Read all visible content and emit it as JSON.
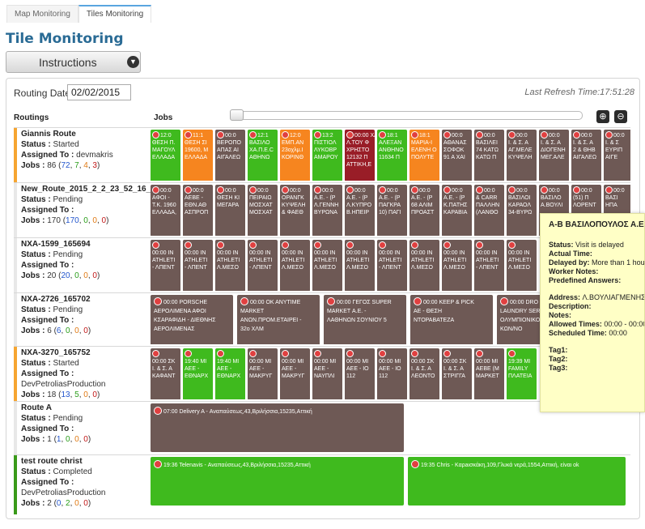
{
  "tabs": [
    "Map Monitoring",
    "Tiles Monitoring"
  ],
  "page_title": "Tile Monitoring",
  "instructions_label": "Instructions",
  "routing_date": {
    "label": "Routing Date",
    "value": "02/02/2015"
  },
  "last_refresh": "Last Refresh Time:17:51:28",
  "columns": {
    "routings": "Routings",
    "jobs": "Jobs"
  },
  "colors": {
    "green": "#3fba1e",
    "orange": "#f6851f",
    "dark": "#6e5955",
    "red": "#991d27",
    "started": "#f6a531",
    "completed": "#3a9a1a",
    "pending": "#e8e8e8"
  },
  "routes": [
    {
      "name": "Giannis Route",
      "status": "Started",
      "assigned": "devmakris",
      "jobs_total": "86",
      "jobs_a": "72",
      "jobs_b": "7",
      "jobs_c": "4",
      "jobs_d": "3",
      "tiles": [
        {
          "c": "g",
          "l": [
            "12:0",
            "ΘΕΣΗ Π.",
            "ΜΑΓΟΥΛ",
            "ΕΛΛΑΔΑ"
          ]
        },
        {
          "c": "o",
          "l": [
            "11:1",
            "ΘΕΣΗ ΣΙ",
            "19600, Μ",
            "ΕΛΛΑΔΑ"
          ]
        },
        {
          "c": "d",
          "l": [
            "00:0",
            "ΒΕΡΟΠΟ",
            "ΑΠΑΣ ΑΙ",
            "ΑΙΓΑΛΕΩ"
          ]
        },
        {
          "c": "g",
          "l": [
            "12:1",
            "ΒΑΣΙΛΟ",
            "ΧΑ.Π.Ε.C",
            "ΑΘΗΝΩ"
          ]
        },
        {
          "c": "o",
          "l": [
            "12:0",
            "ΕΜΠ.ΑΝ",
            "23οχλμ.Ι",
            "ΚΟΡΙΝΘ"
          ]
        },
        {
          "c": "g",
          "l": [
            "13:2",
            "ΠΙΣΤΙΟΛ",
            "ΛΥΚΟΒΡ",
            "ΑΜΑΡΟΥ"
          ]
        },
        {
          "c": "r",
          "l": [
            "00:00 ΧΑ",
            "Λ.ΤΟΥ Φ",
            "ΧΡΗΣΤΟ",
            "12132 Π",
            "ΑΤΤΙΚΗ,Ε"
          ]
        },
        {
          "c": "g",
          "l": [
            "18:1",
            "ΑΛΕΞΑΝ",
            "ΑΝΘΗΝΟ",
            "11634 Π"
          ]
        },
        {
          "c": "o",
          "l": [
            "18:1",
            "ΜΑΡΙΑ-Ι",
            "ΕΛΕΝΗ Ο",
            "ΠΟΛΥΤΕ"
          ]
        },
        {
          "c": "d",
          "l": [
            "00:0",
            "ΑΘΑΝΑΣ",
            "ΣΟΦΟΚ",
            "91 Α ΧΑΙ"
          ]
        },
        {
          "c": "d",
          "l": [
            "00:0",
            "ΒΑΣΙΛΕΙ",
            "74 ΚΑΤΩ",
            "ΚΑΤΩ Π"
          ]
        },
        {
          "c": "d",
          "l": [
            "00:0",
            "Ι. & Σ. Α",
            "ΑΓ.ΜΕΛΕ",
            "ΚΥΨΕΛΗ"
          ]
        },
        {
          "c": "d",
          "l": [
            "00:0",
            "Ι. & Σ. Α",
            "ΔΙΟΓΕΝΗ",
            "ΜΕΓ.ΑΛΕ"
          ]
        },
        {
          "c": "d",
          "l": [
            "00:0",
            "Ι. & Σ. Α",
            "2 & ΘΗΒ",
            "ΑΙΓΑΛΕΩ"
          ]
        },
        {
          "c": "d",
          "l": [
            "00:0",
            "Ι. & Σ",
            "ΕΥΡΙΠ",
            "ΑΙΓΕ"
          ]
        }
      ]
    },
    {
      "name": "New_Route_2015_2_2_23_52_16_748",
      "status": "Pending",
      "assigned": "",
      "jobs_total": "170",
      "jobs_a": "170",
      "jobs_b": "0",
      "jobs_c": "0",
      "jobs_d": "0",
      "tiles": [
        {
          "c": "d",
          "l": [
            "00:0",
            "ΑΦΟΙ - ",
            "Τ.Κ. 1960",
            "ΕΛΛΑΔΑ,"
          ]
        },
        {
          "c": "d",
          "l": [
            "00:0",
            "ΑΕΒΕ - ",
            "ΕΘΝ.ΑΘ",
            "ΑΣΠΡΟΠ"
          ]
        },
        {
          "c": "d",
          "l": [
            "00:0",
            "ΘΕΣΗ ΚΙ",
            "ΜΕΓΑΡΑ"
          ]
        },
        {
          "c": "d",
          "l": [
            "00:0",
            "ΠΕΙΡΑΙΩ",
            "ΜΟΣΧΑΤ",
            "ΜΟΣΧΑΤ"
          ]
        },
        {
          "c": "d",
          "l": [
            "00:0",
            "ΟΡΑΝΓΚ",
            "ΚΥΨΕΛΗ",
            "& ΦΑΕΘ"
          ]
        },
        {
          "c": "d",
          "l": [
            "00:0",
            "Α.Ε. - (Ρ",
            "Λ.ΓΕΝΝΗ",
            "ΒΥΡΩΝΑ"
          ]
        },
        {
          "c": "d",
          "l": [
            "00:0",
            "Α.Ε. - (Ρ",
            "Λ.ΚΥΠΡΟ",
            "Β.ΗΠΕΙΡ"
          ]
        },
        {
          "c": "d",
          "l": [
            "00:0",
            "Α.Ε. - (Ρ",
            "ΠΑΓΚΡΑ",
            "10) ΠΑΓΙ"
          ]
        },
        {
          "c": "d",
          "l": [
            "00:0",
            "Α.Ε. - (Ρ",
            "68 ΑΛΙΜ",
            "ΠΡΟΑΣΤ"
          ]
        },
        {
          "c": "d",
          "l": [
            "00:0",
            "Α.Ε. - (Ρ",
            "Κ.ΠΑΤΗΣ",
            "ΚΑΡΑΒΙΑ"
          ]
        },
        {
          "c": "d",
          "l": [
            "00:0",
            "& CARR",
            "ΠΑΛΛΗΝ",
            "(ΛΑΝΘΟ"
          ]
        },
        {
          "c": "d",
          "l": [
            "00:0",
            "ΒΑΣΙΛΟΙ",
            "ΚΑΡΑΟΛ",
            "34-ΒΥΡΩ"
          ]
        },
        {
          "c": "d",
          "l": [
            "00:0",
            "ΒΑΣΙΛΟ",
            "Α.ΒΟΥΛΙ"
          ]
        },
        {
          "c": "d",
          "l": [
            "00:0",
            "(51) Π",
            "ΛΟΡΕΝΤ"
          ]
        },
        {
          "c": "d",
          "l": [
            "00:0",
            "ΒΑΣΙ",
            "ΗΠΑ"
          ]
        }
      ]
    },
    {
      "name": "NXA-1599_165694",
      "status": "Pending",
      "assigned": "",
      "jobs_total": "20",
      "jobs_a": "20",
      "jobs_b": "0",
      "jobs_c": "0",
      "jobs_d": "0",
      "tiles": [
        {
          "c": "d",
          "w": 1,
          "l": [
            "",
            "00:00 IN",
            "ATHLETI",
            "- ΛΠΕΝΤ"
          ]
        },
        {
          "c": "d",
          "w": 1,
          "l": [
            "",
            "00:00 IN",
            "ATHLETI",
            "- ΛΠΕΝΤ"
          ]
        },
        {
          "c": "d",
          "w": 1,
          "l": [
            "",
            "00:00 IN",
            "ATHLETI",
            "Λ.ΜΕΣΟ"
          ]
        },
        {
          "c": "d",
          "w": 1,
          "l": [
            "",
            "00:00 IN",
            "ATHLETI",
            "- ΛΠΕΝΤ"
          ]
        },
        {
          "c": "d",
          "w": 1,
          "l": [
            "",
            "00:00 IN",
            "ATHLETI",
            "Λ.ΜΕΣΟ"
          ]
        },
        {
          "c": "d",
          "w": 1,
          "l": [
            "",
            "00:00 IN",
            "ATHLETI",
            "Λ.ΜΕΣΟ"
          ]
        },
        {
          "c": "d",
          "w": 1,
          "l": [
            "",
            "00:00 IN",
            "ATHLETI",
            "Λ.ΜΕΣΟ"
          ]
        },
        {
          "c": "d",
          "w": 1,
          "l": [
            "",
            "00:00 IN",
            "ATHLETI",
            "- ΛΠΕΝΤ"
          ]
        },
        {
          "c": "d",
          "w": 1,
          "l": [
            "",
            "00:00 IN",
            "ATHLETI",
            "Λ.ΜΕΣΟ"
          ]
        },
        {
          "c": "d",
          "w": 1,
          "l": [
            "",
            "00:00 IN",
            "ATHLETI",
            "Λ.ΜΕΣΟ"
          ]
        },
        {
          "c": "d",
          "w": 1,
          "l": [
            "",
            "00:00 IN",
            "ATHLETI",
            "- ΛΠΕΝΤ"
          ]
        },
        {
          "c": "d",
          "w": 1,
          "l": [
            "",
            "00:00 IN",
            "ATHLETI",
            "Λ.ΜΕΣΟ"
          ]
        }
      ]
    },
    {
      "name": "NXA-2726_165702",
      "status": "Pending",
      "assigned": "",
      "jobs_total": "6",
      "jobs_a": "6",
      "jobs_b": "0",
      "jobs_c": "0",
      "jobs_d": "0",
      "wide": [
        {
          "l": [
            "00:00 PORSCHE",
            "ΑΕΡΟΛΙΜΕΝΑ ΑΦΟΙ",
            "ΚΣΑΡΑΦΙΔΗ - ΔΙΕΘΝΗΣ",
            "ΑΕΡΟΛΙΜΕΝΑΣ"
          ]
        },
        {
          "l": [
            "00:00 OK ANYTIME",
            "MARKET",
            "ΑΝΩΝ.ΠΡΟΜ.ΕΤΑΙΡΕΙ -",
            "32ο ΧΛΜ"
          ]
        },
        {
          "l": [
            "00:00 ΓΕΓΟΣ SUPER",
            "MARKET Α.Ε. -",
            "ΛΑΘΗΝΩΝ ΣΟΥΝΙΟΥ 5"
          ]
        },
        {
          "l": [
            "00:00 KEEP & PICK",
            "ΑΕ - ΘΕΣΗ",
            "ΝΤΟΡΑΒΑΤΕΖΑ"
          ]
        },
        {
          "l": [
            "00:00 DRO",
            "LAUNDRY SERV",
            "ΟΛΥΜΠΙΟΝΙΚΟ",
            "ΚΩΝ/ΝΟ"
          ]
        }
      ]
    },
    {
      "name": "NXA-3270_165752",
      "status": "Started",
      "assigned": "DevPetroliasProduction",
      "jobs_total": "18",
      "jobs_a": "13",
      "jobs_b": "5",
      "jobs_c": "0",
      "jobs_d": "0",
      "tiles": [
        {
          "c": "d",
          "w": 1,
          "l": [
            "",
            "00:00 ΣΚ",
            "Ι. & Σ. Α",
            "ΚΑΦΑΝΤ"
          ]
        },
        {
          "c": "g",
          "w": 1,
          "l": [
            "",
            "19:40 ΜΙ",
            "ΑΕΕ - ",
            "ΕΘΝΑΡΧ"
          ]
        },
        {
          "c": "g",
          "w": 1,
          "l": [
            "",
            "19:40 ΜΙ",
            "ΑΕΕ - ",
            "ΕΘΝΑΡΧ"
          ]
        },
        {
          "c": "d",
          "w": 1,
          "l": [
            "",
            "00:00 ΜΙ",
            "ΑΕΕ - ",
            "ΜΑΚΡΥΓ"
          ]
        },
        {
          "c": "d",
          "w": 1,
          "l": [
            "",
            "00:00 ΜΙ",
            "ΑΕΕ - ",
            "ΜΑΚΡΥΓ"
          ]
        },
        {
          "c": "d",
          "w": 1,
          "l": [
            "",
            "00:00 ΜΙ",
            "ΑΕΕ - ",
            "ΝΑΥΠΛΙ"
          ]
        },
        {
          "c": "d",
          "w": 1,
          "l": [
            "",
            "00:00 ΜΙ",
            "ΑΕΕ - ΙΟ",
            "112"
          ]
        },
        {
          "c": "d",
          "w": 1,
          "l": [
            "",
            "00:00 ΜΙ",
            "ΑΕΕ - ΙΟ",
            "112"
          ]
        },
        {
          "c": "d",
          "w": 1,
          "l": [
            "",
            "00:00 ΣΚ",
            "Ι. & Σ. Α",
            "ΛΕΟΝΤΟ"
          ]
        },
        {
          "c": "d",
          "w": 1,
          "l": [
            "",
            "00:00 ΣΚ",
            "Ι. & Σ. Α",
            "ΣΤΡΙΓΓΑ"
          ]
        },
        {
          "c": "d",
          "w": 1,
          "l": [
            "",
            "00:00 ΜΙ",
            "ΑΕΒΕ (Μ",
            "ΜΑΡΚΕΤ"
          ]
        },
        {
          "c": "g",
          "w": 1,
          "l": [
            "",
            "19:39 ΜΙ",
            "FAMILY",
            "ΠΛΑΤΕΙΑ"
          ]
        }
      ]
    },
    {
      "name": "Route A",
      "status": "Pending",
      "assigned": "",
      "jobs_total": "1",
      "jobs_a": "1",
      "jobs_b": "0",
      "jobs_c": "0",
      "jobs_d": "0",
      "big": [
        {
          "c": "d",
          "text": "07:00 Delivery A  - Αναπαύσεως,43,Βριλήσσια,15235,Αττική"
        }
      ]
    },
    {
      "name": "test route christ",
      "status": "Completed",
      "assigned": "DevPetroliasProduction",
      "jobs_total": "2",
      "jobs_a": "0",
      "jobs_b": "2",
      "jobs_c": "0",
      "jobs_d": "0",
      "big": [
        {
          "c": "g",
          "text": "19:36 Telenavis  - Αναπαύσεως,43,Βριλήσσια,15235,Αττική"
        },
        {
          "c": "g",
          "text": "19:35 Chris  - Καρaισκάκη,109,Γλυκά νερά,1554,Αττική, είναι ok"
        }
      ]
    }
  ],
  "labels": {
    "status": "Status :",
    "assigned": "Assigned To :",
    "jobs": "Jobs :"
  },
  "tooltip": {
    "title": "Α-Β ΒΑΣΙΛΟΠΟΥΛΟΣ Α.Ε.",
    "status": "Visit is delayed",
    "actual_time": "",
    "delayed_by": "More than 1 hour",
    "worker_notes": "",
    "predefined_answers": "",
    "address": "Λ.ΒΟΥΛΙΑΓΜΕΝΗΣ",
    "description": "",
    "notes": "",
    "allowed_times": "00:00 - 00:00",
    "scheduled_time": "00:00",
    "tag1": "",
    "tag2": "",
    "tag3": "",
    "labels": {
      "status": "Status:",
      "actual_time": "Actual Time:",
      "delayed_by": "Delayed by:",
      "worker_notes": "Worker Notes:",
      "predefined_answers": "Predefined Answers:",
      "address": "Address:",
      "description": "Description:",
      "notes": "Notes:",
      "allowed_times": "Allowed Times:",
      "scheduled_time": "Scheduled Time:",
      "tag1": "Tag1:",
      "tag2": "Tag2:",
      "tag3": "Tag3:"
    }
  }
}
